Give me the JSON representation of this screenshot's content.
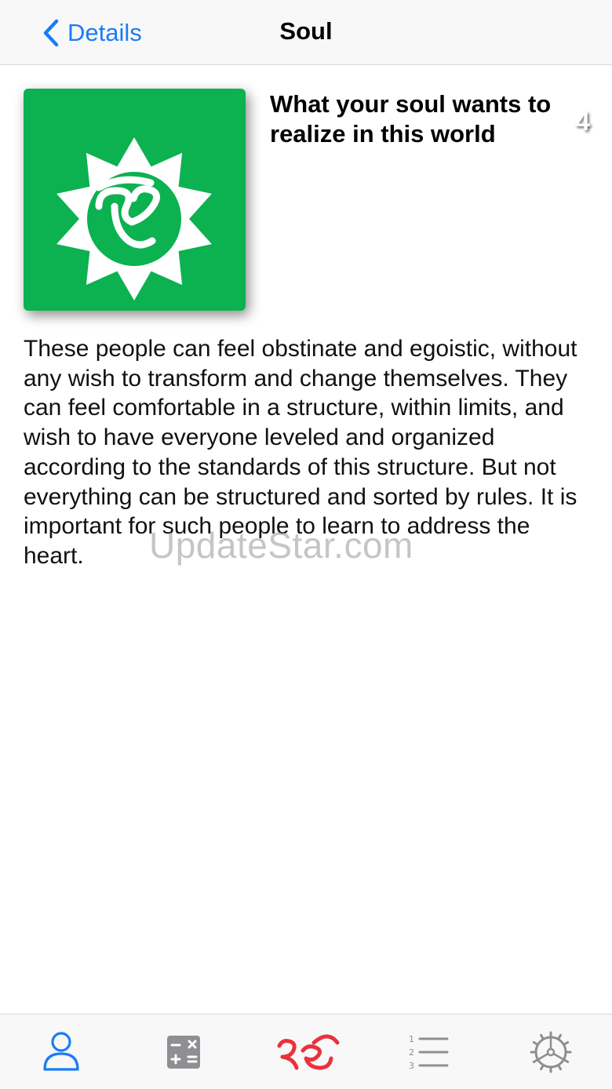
{
  "navbar": {
    "back_label": "Details",
    "title": "Soul"
  },
  "card": {
    "number": "4",
    "background": "#0cb150"
  },
  "content": {
    "heading": "What your soul wants to realize in this world",
    "body": "These people can feel obstinate and egoistic, without any wish to transform and change themselves. They can feel comfortable in a structure, within limits, and wish to have everyone leveled and organized according to the standards of this structure. But not everything can be structured and sorted by rules. It is important for such people to learn to address the heart."
  },
  "watermark": "UpdateStar.com",
  "tabbar": {
    "tabs": [
      {
        "icon": "person-icon",
        "selected": true
      },
      {
        "icon": "calculator-icon",
        "selected": false
      },
      {
        "icon": "ik-onkar-icon",
        "selected": false
      },
      {
        "icon": "numbered-list-icon",
        "selected": false
      },
      {
        "icon": "settings-gear-icon",
        "selected": false
      }
    ]
  },
  "colors": {
    "accent": "#1a7cf5",
    "card_green": "#0cb150",
    "ik_onkar_red": "#e8323c",
    "inactive_icon": "#8e8e93"
  }
}
